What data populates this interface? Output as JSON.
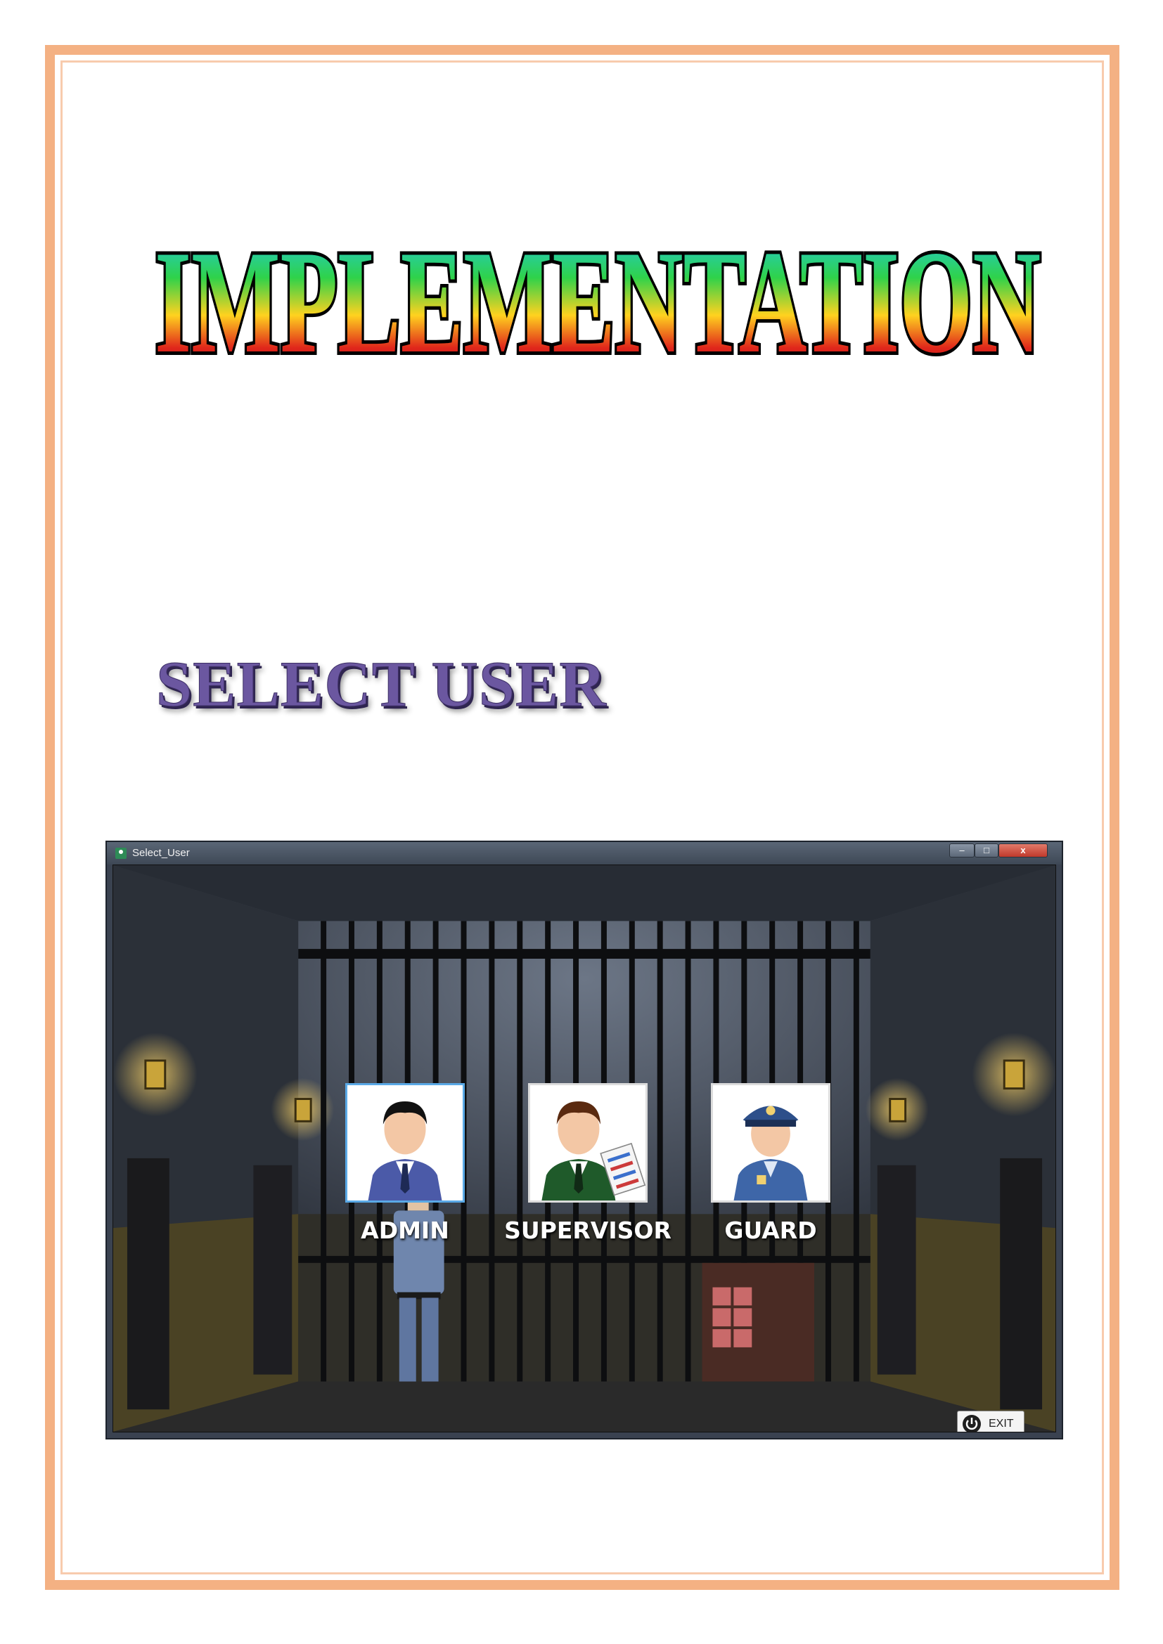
{
  "document": {
    "title": "IMPLEMENTATION",
    "section_heading": "SELECT USER"
  },
  "window": {
    "title": "Select_User",
    "controls": {
      "minimize": "–",
      "maximize": "□",
      "close": "x"
    }
  },
  "users": [
    {
      "label": "ADMIN",
      "icon": "admin-user-icon",
      "selected": true
    },
    {
      "label": "SUPERVISOR",
      "icon": "supervisor-user-icon",
      "selected": false
    },
    {
      "label": "GUARD",
      "icon": "guard-user-icon",
      "selected": false
    }
  ],
  "exit_button": {
    "label": "EXIT",
    "icon": "power-icon"
  },
  "colors": {
    "page_border": "#f4b183",
    "heading": "#6b57a0",
    "selected_card_border": "#5aa9e6"
  }
}
